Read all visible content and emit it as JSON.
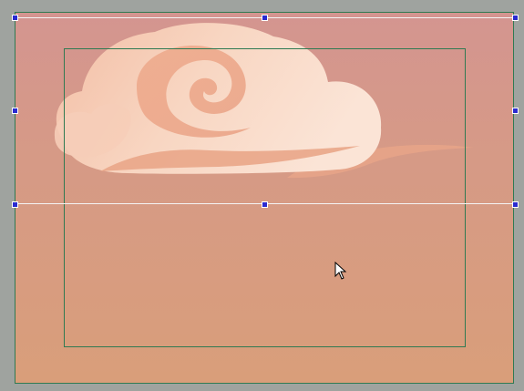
{
  "editor": {
    "workspace_color": "#9fa39f",
    "canvas_gradient": [
      "#d49590",
      "#d99e7a"
    ],
    "frame_color": "#2f7a52",
    "handle_color": "#2a2ad0"
  },
  "selection": {
    "object": "cloud-image",
    "handles": [
      "top-left",
      "top-center",
      "top-right",
      "middle-left",
      "middle-right",
      "bottom-left",
      "bottom-center",
      "bottom-right"
    ]
  },
  "cursor": {
    "icon": "arrow-pointer-icon"
  }
}
